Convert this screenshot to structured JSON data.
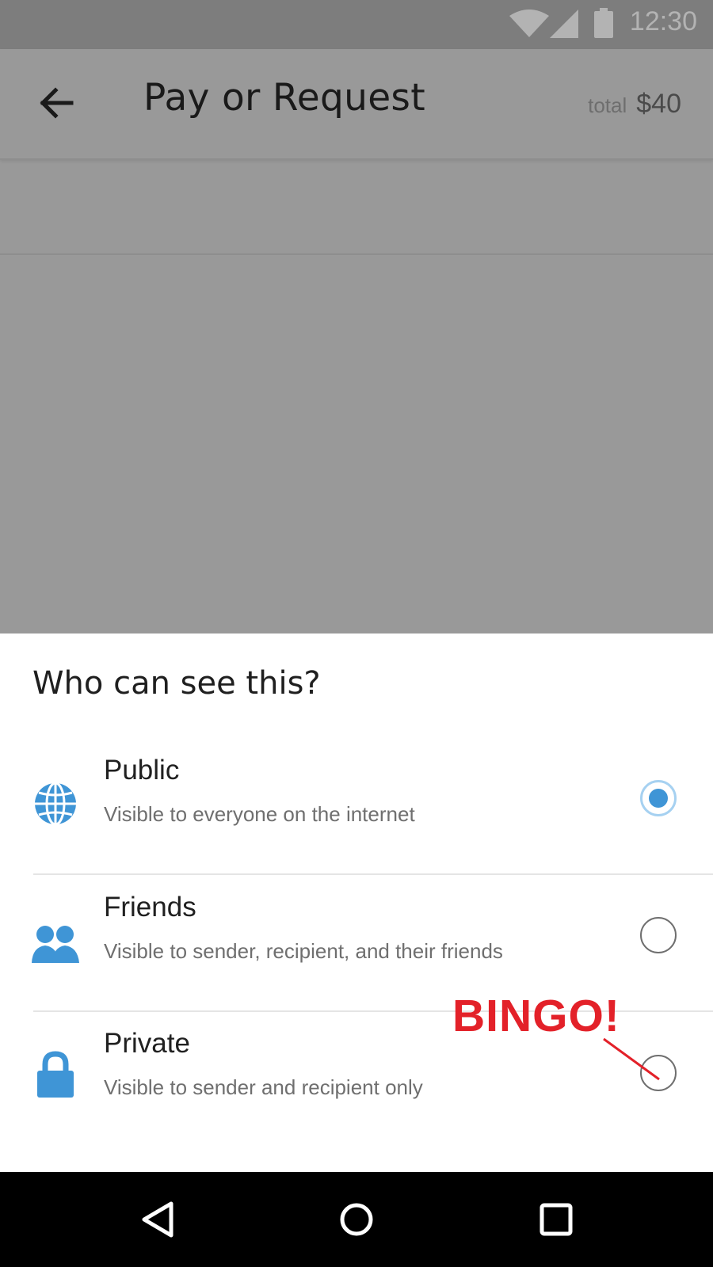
{
  "status_bar": {
    "time": "12:30",
    "icons": [
      "wifi-icon",
      "cell-signal-icon",
      "battery-icon"
    ]
  },
  "app_bar": {
    "title": "Pay or Request",
    "total_label": "total",
    "total_value": "$40",
    "back_icon": "arrow-left-icon"
  },
  "sheet": {
    "title": "Who can see this?",
    "options": [
      {
        "label": "Public",
        "description": "Visible to everyone on the internet",
        "icon": "globe-icon",
        "selected": true
      },
      {
        "label": "Friends",
        "description": "Visible to sender, recipient, and their friends",
        "icon": "friends-icon",
        "selected": false
      },
      {
        "label": "Private",
        "description": "Visible to sender and recipient only",
        "icon": "lock-icon",
        "selected": false
      }
    ]
  },
  "annotation": {
    "text": "BINGO!",
    "color": "#e32129"
  },
  "nav_bar": {
    "buttons": [
      "back-triangle-icon",
      "home-circle-icon",
      "recents-square-icon"
    ]
  },
  "colors": {
    "accent": "#3f95d6",
    "scrim": "#999999",
    "status_bar": "#7d7d7d"
  }
}
